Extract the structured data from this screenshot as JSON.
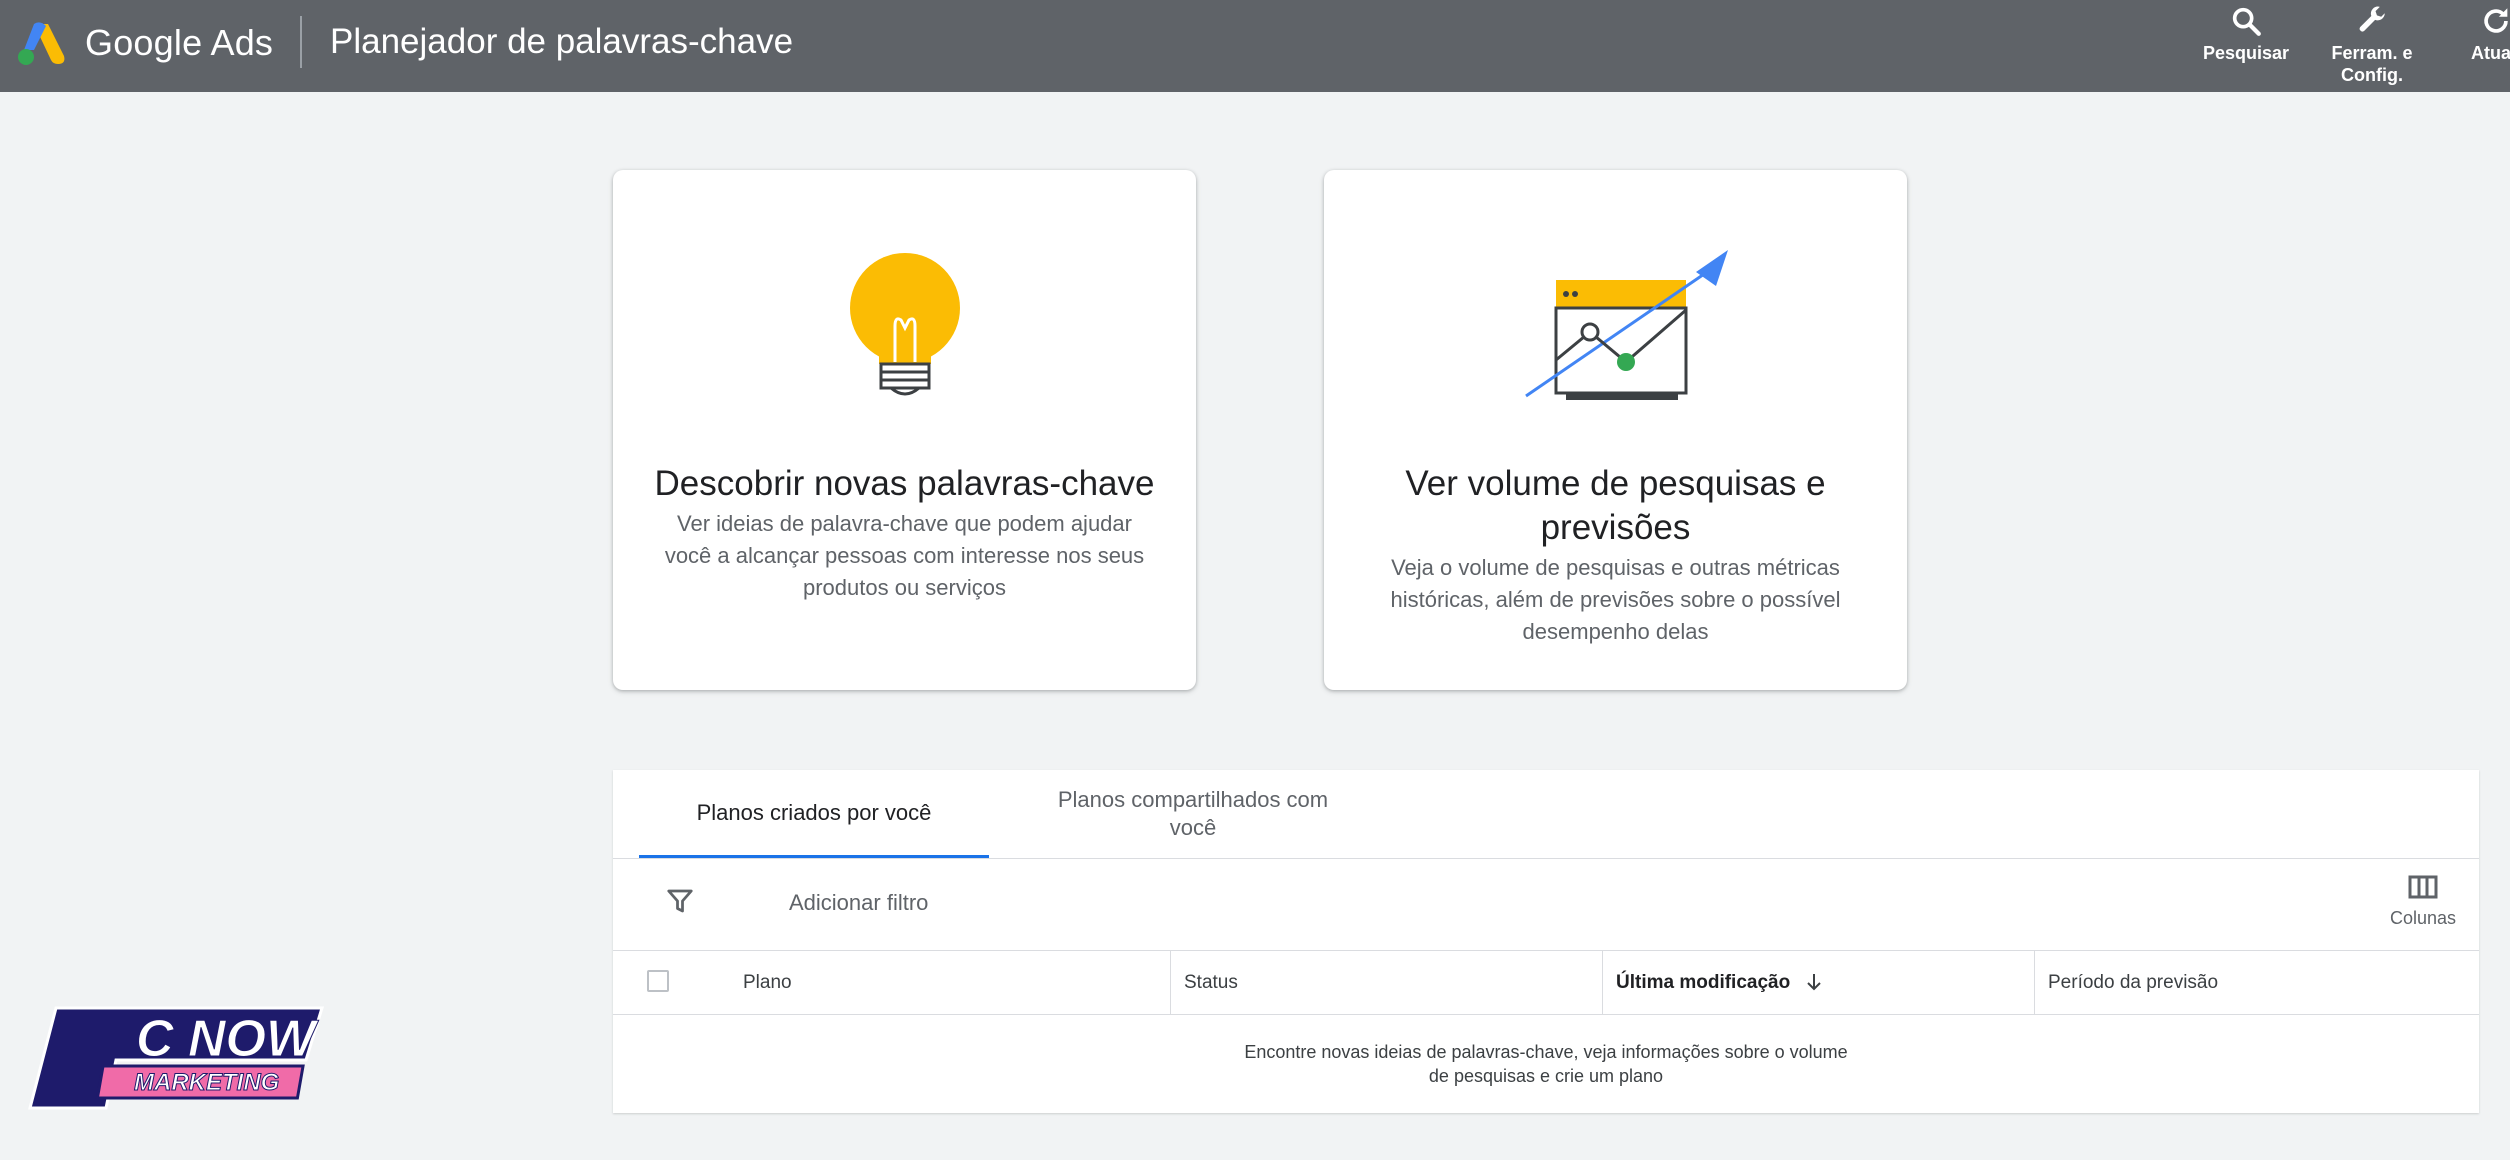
{
  "header": {
    "brand": "Google Ads",
    "page_title": "Planejador de palavras-chave",
    "actions": [
      {
        "label": "Pesquisar",
        "icon": "search-icon"
      },
      {
        "label_line1": "Ferram. e",
        "label_line2": "Config.",
        "icon": "wrench-icon"
      },
      {
        "label": "Atuali",
        "icon": "refresh-icon"
      }
    ]
  },
  "cards": [
    {
      "title": "Descobrir novas palavras-chave",
      "description_lines": [
        "Ver ideias de palavra-chave que podem ajudar",
        "você a alcançar pessoas com interesse nos seus",
        "produtos ou serviços"
      ],
      "icon": "lightbulb-icon"
    },
    {
      "title_lines": [
        "Ver volume de pesquisas e",
        "previsões"
      ],
      "description_lines": [
        "Veja o volume de pesquisas e outras métricas",
        "históricas, além de previsões sobre o possível",
        "desempenho delas"
      ],
      "icon": "trend-chart-icon"
    }
  ],
  "plans": {
    "tabs": [
      {
        "label": "Planos criados por você",
        "active": true
      },
      {
        "label_line1": "Planos compartilhados com",
        "label_line2": "você",
        "active": false
      }
    ],
    "add_filter_label": "Adicionar filtro",
    "columns_label": "Colunas",
    "table_headers": [
      "Plano",
      "Status",
      "Última modificação",
      "Período da previsão"
    ],
    "empty_message_lines": [
      "Encontre novas ideias de palavras-chave, veja informações sobre o volume",
      "de pesquisas e crie um plano"
    ]
  },
  "watermark": {
    "line1": "C NOW",
    "line2": "MARKETING"
  },
  "colors": {
    "header_bg": "#5f6368",
    "page_bg": "#f1f3f4",
    "accent_blue": "#1a73e8",
    "bulb_yellow": "#fbbc04",
    "trend_green": "#34a853",
    "arrow_blue": "#4285f4"
  }
}
